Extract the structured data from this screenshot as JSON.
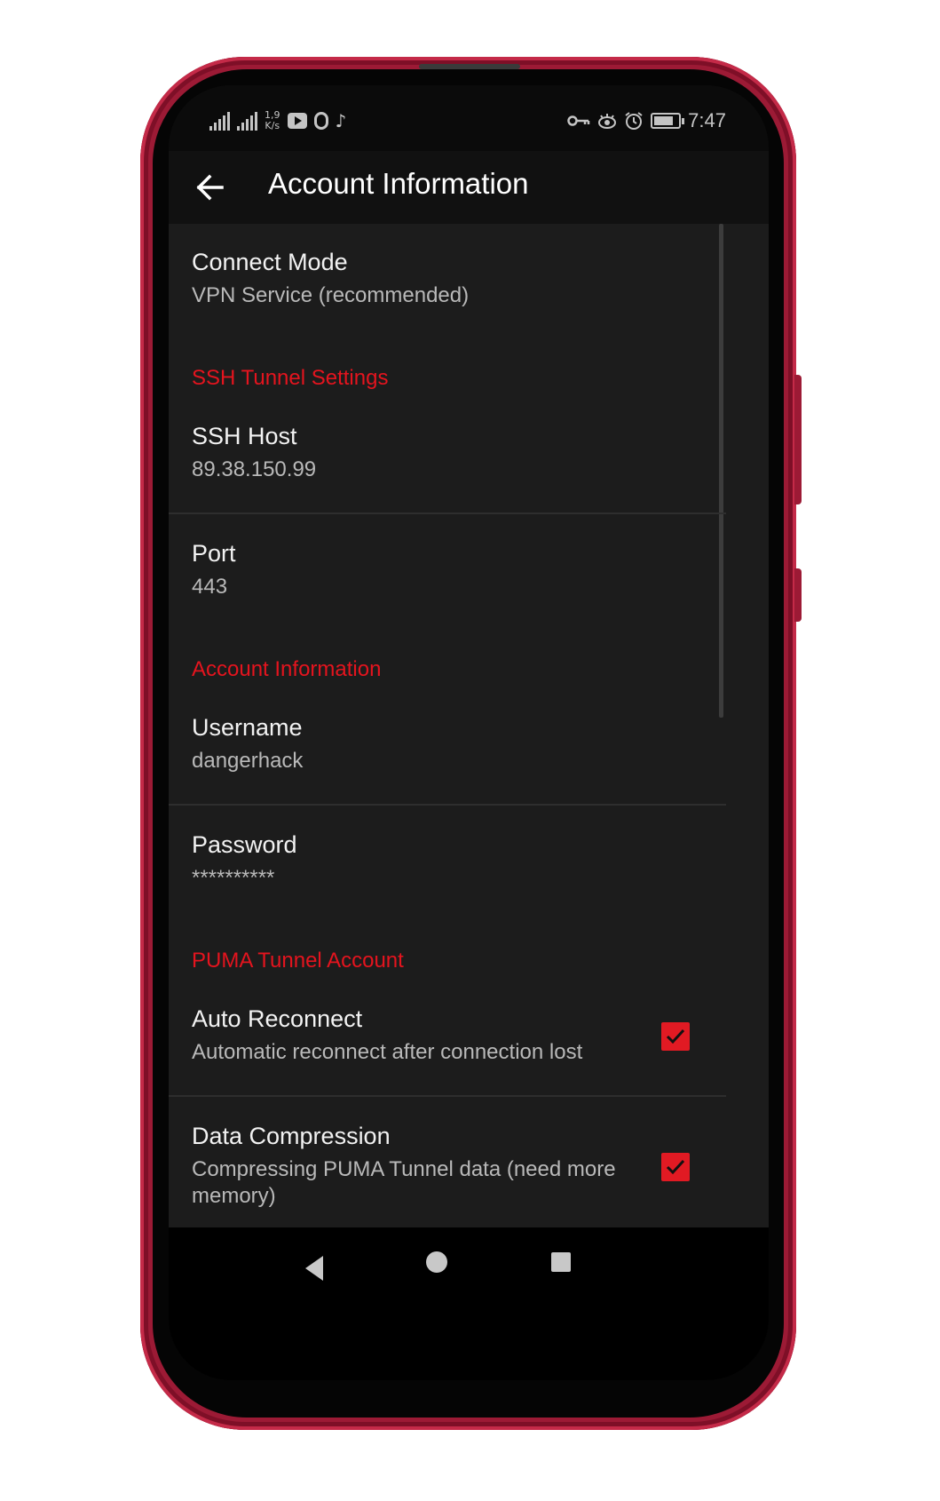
{
  "status_bar": {
    "net_speed_top": "1,9",
    "net_speed_bottom": "K/s",
    "music_icon": "♪",
    "key_icon": "⊶",
    "eye_icon": "ö",
    "alarm_icon": "⏰",
    "time": "7:47"
  },
  "app_bar": {
    "back_icon": "arrow-left",
    "title": "Account Information"
  },
  "settings": {
    "connect_mode": {
      "title": "Connect Mode",
      "summary": "VPN Service (recommended)"
    },
    "ssh_category": "SSH Tunnel Settings",
    "ssh_host": {
      "title": "SSH Host",
      "summary": "89.38.150.99"
    },
    "port": {
      "title": "Port",
      "summary": "443"
    },
    "account_category": "Account Information",
    "username": {
      "title": "Username",
      "summary": "dangerhack"
    },
    "password": {
      "title": "Password",
      "summary": "**********"
    },
    "puma_category": "PUMA Tunnel Account",
    "auto_reconnect": {
      "title": "Auto Reconnect",
      "summary": "Automatic reconnect after connection lost",
      "checked": true
    },
    "data_compression": {
      "title": "Data Compression",
      "summary": "Compressing PUMA Tunnel data (need more memory)",
      "checked": true
    }
  },
  "colors": {
    "accent": "#e4141e",
    "frame": "#9c1a35",
    "background": "#1c1c1c"
  }
}
